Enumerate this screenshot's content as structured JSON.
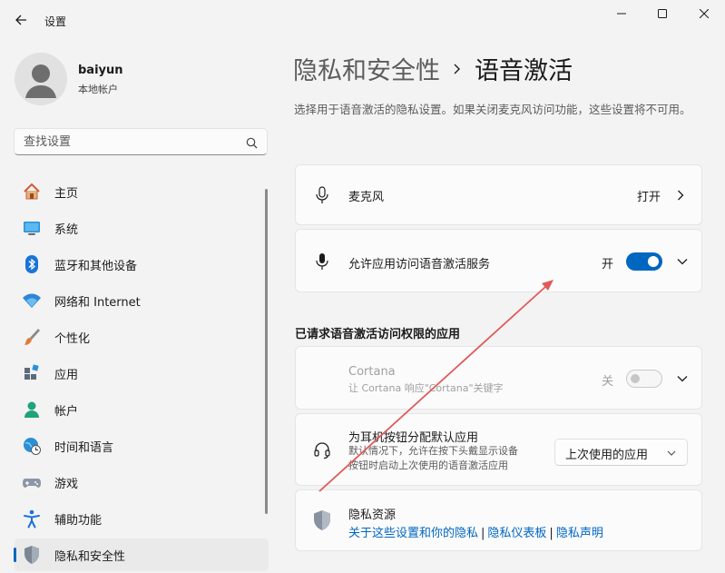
{
  "window": {
    "title": "设置",
    "icons": {
      "back": "back-arrow-icon",
      "minimize": "minimize-icon",
      "maximize": "maximize-icon",
      "close": "close-icon"
    }
  },
  "profile": {
    "name": "baiyun",
    "account_type": "本地帐户"
  },
  "search": {
    "placeholder": "查找设置",
    "icon": "search-icon"
  },
  "sidebar": {
    "items": [
      {
        "label": "主页",
        "icon": "home-icon"
      },
      {
        "label": "系统",
        "icon": "monitor-icon"
      },
      {
        "label": "蓝牙和其他设备",
        "icon": "bluetooth-icon"
      },
      {
        "label": "网络和 Internet",
        "icon": "wifi-icon"
      },
      {
        "label": "个性化",
        "icon": "brush-icon"
      },
      {
        "label": "应用",
        "icon": "apps-icon"
      },
      {
        "label": "帐户",
        "icon": "person-icon"
      },
      {
        "label": "时间和语言",
        "icon": "globe-clock-icon"
      },
      {
        "label": "游戏",
        "icon": "gamepad-icon"
      },
      {
        "label": "辅助功能",
        "icon": "accessibility-icon"
      },
      {
        "label": "隐私和安全性",
        "icon": "shield-icon",
        "active": true
      }
    ]
  },
  "page": {
    "breadcrumb_parent": "隐私和安全性",
    "breadcrumb_current": "语音激活",
    "description": "选择用于语音激活的隐私设置。如果关闭麦克风访问功能，这些设置将不可用。"
  },
  "microphone": {
    "label": "麦克风",
    "state": "打开"
  },
  "voice_access": {
    "label": "允许应用访问语音激活服务",
    "state": "开",
    "toggle_on": true
  },
  "apps_section_title": "已请求语音激活访问权限的应用",
  "cortana": {
    "label": "Cortana",
    "sub": "让 Cortana 响应\"Cortana\"关键字",
    "state": "关",
    "toggle_on": false
  },
  "headset": {
    "label": "为耳机按钮分配默认应用",
    "sub_line1": "默认情况下，允许在按下头戴显示设备",
    "sub_line2": "按钮时启动上次使用的语音激活应用",
    "dropdown_value": "上次使用的应用"
  },
  "privacy": {
    "label": "隐私资源",
    "link1": "关于这些设置和你的隐私",
    "link2": "隐私仪表板",
    "link3": "隐私声明",
    "separator": "|"
  },
  "colors": {
    "accent": "#0067c0",
    "annotation_arrow": "#e05a5a"
  }
}
